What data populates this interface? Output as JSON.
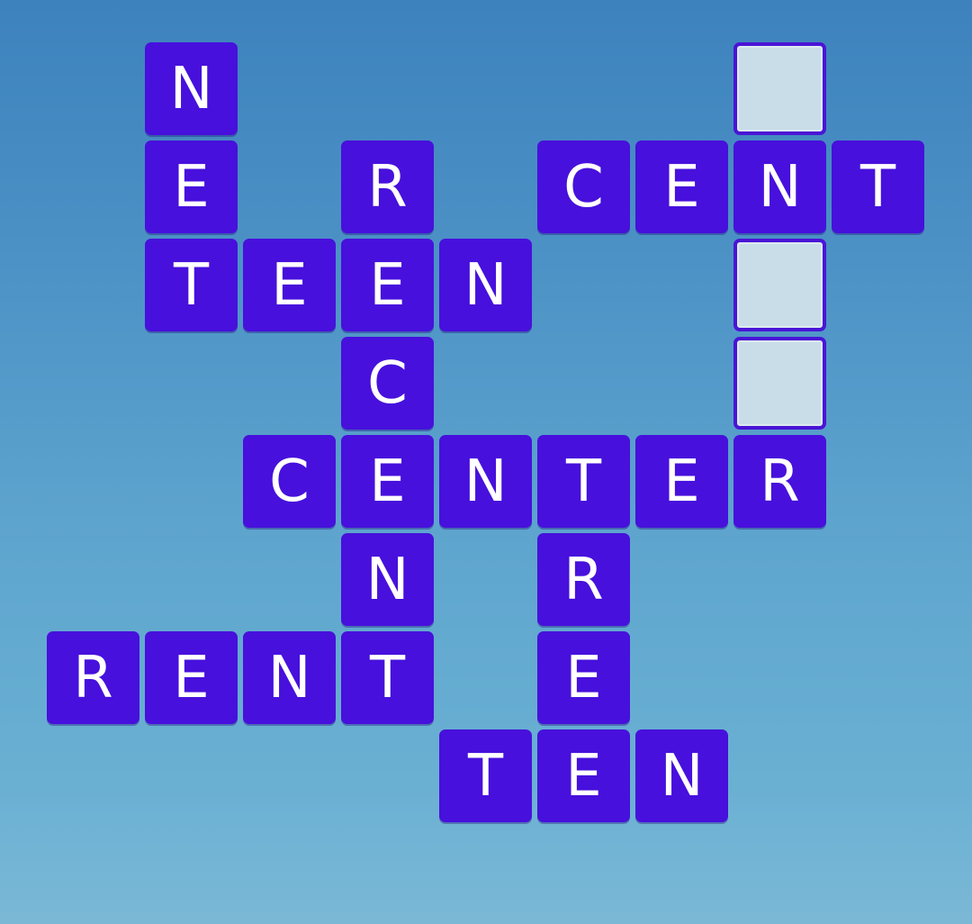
{
  "puzzle": {
    "tile_color": "#4710dc",
    "empty_tile_color": "#c9dde9",
    "grid": [
      {
        "row": 0,
        "col": 1,
        "letter": "N"
      },
      {
        "row": 0,
        "col": 7,
        "letter": ""
      },
      {
        "row": 1,
        "col": 1,
        "letter": "E"
      },
      {
        "row": 1,
        "col": 3,
        "letter": "R"
      },
      {
        "row": 1,
        "col": 5,
        "letter": "C"
      },
      {
        "row": 1,
        "col": 6,
        "letter": "E"
      },
      {
        "row": 1,
        "col": 7,
        "letter": "N"
      },
      {
        "row": 1,
        "col": 8,
        "letter": "T"
      },
      {
        "row": 2,
        "col": 1,
        "letter": "T"
      },
      {
        "row": 2,
        "col": 2,
        "letter": "E"
      },
      {
        "row": 2,
        "col": 3,
        "letter": "E"
      },
      {
        "row": 2,
        "col": 4,
        "letter": "N"
      },
      {
        "row": 2,
        "col": 7,
        "letter": ""
      },
      {
        "row": 3,
        "col": 3,
        "letter": "C"
      },
      {
        "row": 3,
        "col": 7,
        "letter": ""
      },
      {
        "row": 4,
        "col": 2,
        "letter": "C"
      },
      {
        "row": 4,
        "col": 3,
        "letter": "E"
      },
      {
        "row": 4,
        "col": 4,
        "letter": "N"
      },
      {
        "row": 4,
        "col": 5,
        "letter": "T"
      },
      {
        "row": 4,
        "col": 6,
        "letter": "E"
      },
      {
        "row": 4,
        "col": 7,
        "letter": "R"
      },
      {
        "row": 5,
        "col": 3,
        "letter": "N"
      },
      {
        "row": 5,
        "col": 5,
        "letter": "R"
      },
      {
        "row": 6,
        "col": 0,
        "letter": "R"
      },
      {
        "row": 6,
        "col": 1,
        "letter": "E"
      },
      {
        "row": 6,
        "col": 2,
        "letter": "N"
      },
      {
        "row": 6,
        "col": 3,
        "letter": "T"
      },
      {
        "row": 6,
        "col": 5,
        "letter": "E"
      },
      {
        "row": 7,
        "col": 4,
        "letter": "T"
      },
      {
        "row": 7,
        "col": 5,
        "letter": "E"
      },
      {
        "row": 7,
        "col": 6,
        "letter": "N"
      }
    ]
  }
}
